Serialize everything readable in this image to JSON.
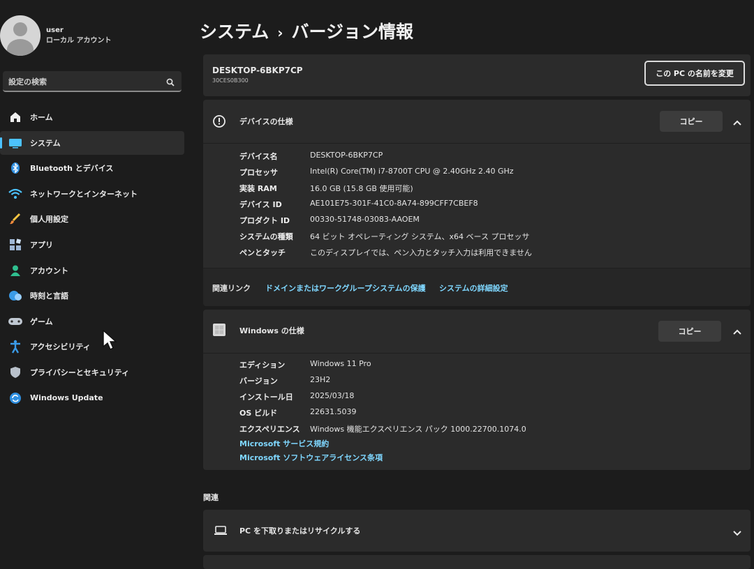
{
  "user": {
    "name": "user",
    "account_type": "ローカル アカウント"
  },
  "search": {
    "placeholder": "設定の検索"
  },
  "nav": [
    {
      "label": "ホーム",
      "icon": "home-icon"
    },
    {
      "label": "システム",
      "icon": "system-icon",
      "active": true
    },
    {
      "label": "Bluetooth とデバイス",
      "icon": "bluetooth-icon"
    },
    {
      "label": "ネットワークとインターネット",
      "icon": "wifi-icon"
    },
    {
      "label": "個人用設定",
      "icon": "brush-icon"
    },
    {
      "label": "アプリ",
      "icon": "apps-icon"
    },
    {
      "label": "アカウント",
      "icon": "accounts-icon"
    },
    {
      "label": "時刻と言語",
      "icon": "globe-icon"
    },
    {
      "label": "ゲーム",
      "icon": "gamepad-icon"
    },
    {
      "label": "アクセシビリティ",
      "icon": "accessibility-icon"
    },
    {
      "label": "プライバシーとセキュリティ",
      "icon": "shield-icon"
    },
    {
      "label": "Windows Update",
      "icon": "update-icon"
    }
  ],
  "breadcrumb": {
    "parent": "システム",
    "separator": "›",
    "current": "バージョン情報"
  },
  "pc": {
    "name": "DESKTOP-6BKP7CP",
    "model": "30CES0B300",
    "rename_label": "この PC の名前を変更"
  },
  "device_specs": {
    "title": "デバイスの仕様",
    "copy_label": "コピー",
    "rows": [
      {
        "key": "デバイス名",
        "value": "DESKTOP-6BKP7CP"
      },
      {
        "key": "プロセッサ",
        "value": "Intel(R) Core(TM) i7-8700T CPU @ 2.40GHz   2.40 GHz"
      },
      {
        "key": "実装 RAM",
        "value": "16.0 GB (15.8 GB 使用可能)"
      },
      {
        "key": "デバイス ID",
        "value": "AE101E75-301F-41C0-8A74-899CFF7CBEF8"
      },
      {
        "key": "プロダクト ID",
        "value": "00330-51748-03083-AAOEM"
      },
      {
        "key": "システムの種類",
        "value": "64 ビット オペレーティング システム、x64 ベース プロセッサ"
      },
      {
        "key": "ペンとタッチ",
        "value": "このディスプレイでは、ペン入力とタッチ入力は利用できません"
      }
    ]
  },
  "related_links": {
    "label": "関連リンク",
    "links": [
      "ドメインまたはワークグループ",
      "システムの保護",
      "システムの詳細設定"
    ]
  },
  "windows_specs": {
    "title": "Windows の仕様",
    "copy_label": "コピー",
    "rows": [
      {
        "key": "エディション",
        "value": "Windows 11 Pro"
      },
      {
        "key": "バージョン",
        "value": "23H2"
      },
      {
        "key": "インストール日",
        "value": "2025/03/18"
      },
      {
        "key": "OS ビルド",
        "value": "22631.5039"
      },
      {
        "key": "エクスペリエンス",
        "value": "Windows 機能エクスペリエンス パック 1000.22700.1074.0"
      }
    ],
    "links": [
      "Microsoft サービス規約",
      "Microsoft ソフトウェアライセンス条項"
    ]
  },
  "related": {
    "title": "関連",
    "item_label": "PC を下取りまたはリサイクルする"
  },
  "colors": {
    "accent": "#4cc2ff",
    "link": "#7fd7ff",
    "card": "#2b2b2b",
    "background": "#1c1c1c"
  }
}
